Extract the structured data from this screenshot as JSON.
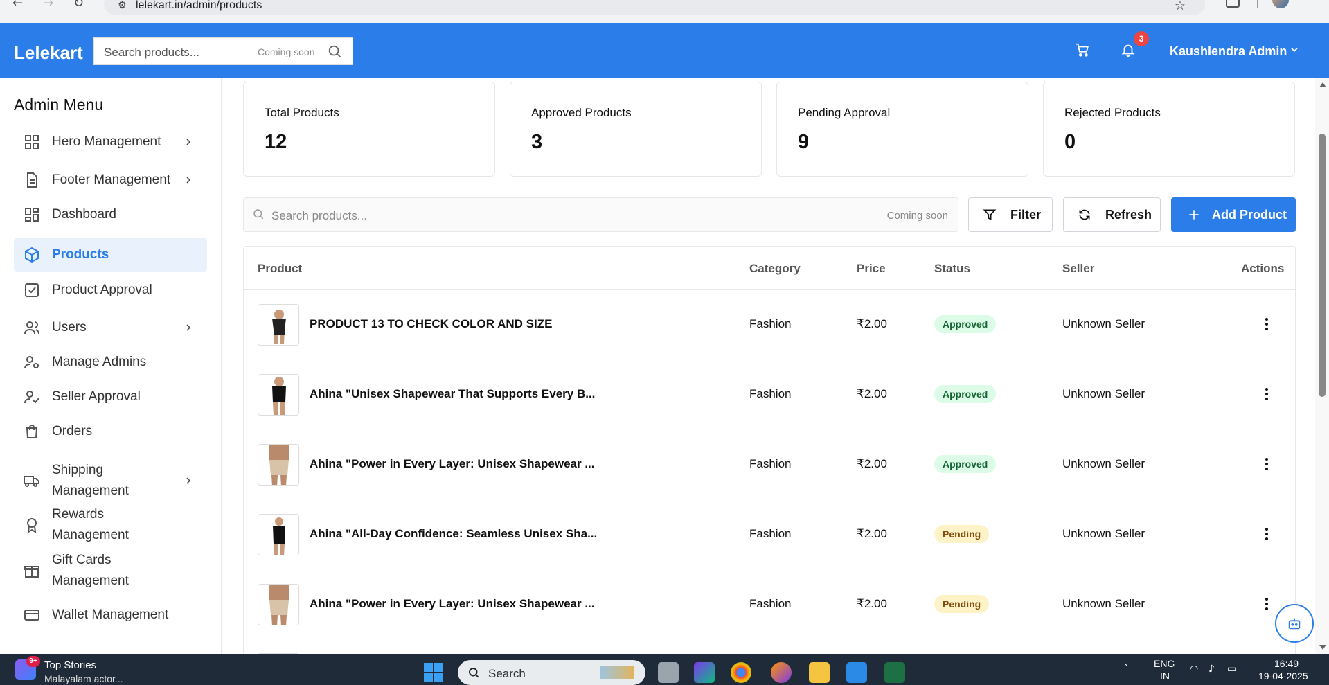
{
  "browser": {
    "url": "lelekart.in/admin/products"
  },
  "header": {
    "brand": "Lelekart",
    "search_placeholder": "Search products...",
    "search_badge": "Coming soon",
    "notifications_count": "3",
    "user_name": "Kaushlendra Admin"
  },
  "sidebar": {
    "title": "Admin Menu",
    "items": [
      {
        "label": "Hero Management",
        "icon": "grid-icon",
        "has_chevron": true
      },
      {
        "label": "Footer Management",
        "icon": "document-icon",
        "has_chevron": true
      },
      {
        "label": "Dashboard",
        "icon": "dashboard-icon",
        "has_chevron": false
      },
      {
        "label": "Products",
        "icon": "box-icon",
        "has_chevron": false,
        "active": true
      },
      {
        "label": "Product Approval",
        "icon": "checkbox-icon",
        "has_chevron": false
      },
      {
        "label": "Users",
        "icon": "users-icon",
        "has_chevron": true
      },
      {
        "label": "Manage Admins",
        "icon": "user-cog-icon",
        "has_chevron": false
      },
      {
        "label": "Seller Approval",
        "icon": "user-check-icon",
        "has_chevron": false
      },
      {
        "label": "Orders",
        "icon": "shopping-bag-icon",
        "has_chevron": false
      },
      {
        "label": "Shipping Management",
        "icon": "truck-icon",
        "has_chevron": true
      },
      {
        "label": "Rewards Management",
        "icon": "award-icon",
        "has_chevron": false
      },
      {
        "label": "Gift Cards Management",
        "icon": "gift-icon",
        "has_chevron": false
      },
      {
        "label": "Wallet Management",
        "icon": "credit-card-icon",
        "has_chevron": false
      }
    ]
  },
  "stats": [
    {
      "title": "Total Products",
      "value": "12"
    },
    {
      "title": "Approved Products",
      "value": "3"
    },
    {
      "title": "Pending Approval",
      "value": "9"
    },
    {
      "title": "Rejected Products",
      "value": "0"
    }
  ],
  "toolbar": {
    "search_placeholder": "Search products...",
    "search_badge": "Coming soon",
    "filter_label": "Filter",
    "refresh_label": "Refresh",
    "add_label": "Add Product"
  },
  "table": {
    "columns": [
      "Product",
      "Category",
      "Price",
      "Status",
      "Seller",
      "Actions"
    ],
    "rows": [
      {
        "name": "PRODUCT 13 TO CHECK COLOR AND SIZE",
        "category": "Fashion",
        "price": "₹2.00",
        "status": "Approved",
        "seller": "Unknown Seller"
      },
      {
        "name": "Ahina \"Unisex Shapewear That Supports Every B...",
        "category": "Fashion",
        "price": "₹2.00",
        "status": "Approved",
        "seller": "Unknown Seller"
      },
      {
        "name": "Ahina \"Power in Every Layer: Unisex Shapewear ...",
        "category": "Fashion",
        "price": "₹2.00",
        "status": "Approved",
        "seller": "Unknown Seller"
      },
      {
        "name": "Ahina \"All-Day Confidence: Seamless Unisex Sha...",
        "category": "Fashion",
        "price": "₹2.00",
        "status": "Pending",
        "seller": "Unknown Seller"
      },
      {
        "name": "Ahina \"Power in Every Layer: Unisex Shapewear ...",
        "category": "Fashion",
        "price": "₹2.00",
        "status": "Pending",
        "seller": "Unknown Seller"
      }
    ]
  },
  "taskbar": {
    "news_badge": "9+",
    "news_title": "Top Stories",
    "news_subtitle": "Malayalam actor...",
    "search_label": "Search",
    "lang_top": "ENG",
    "lang_bottom": "IN",
    "time": "16:49",
    "date": "19-04-2025"
  },
  "colors": {
    "accent": "#2b7de9",
    "approved_bg": "#dcfce7",
    "pending_bg": "#fef3c7",
    "badge": "#ef4444"
  }
}
